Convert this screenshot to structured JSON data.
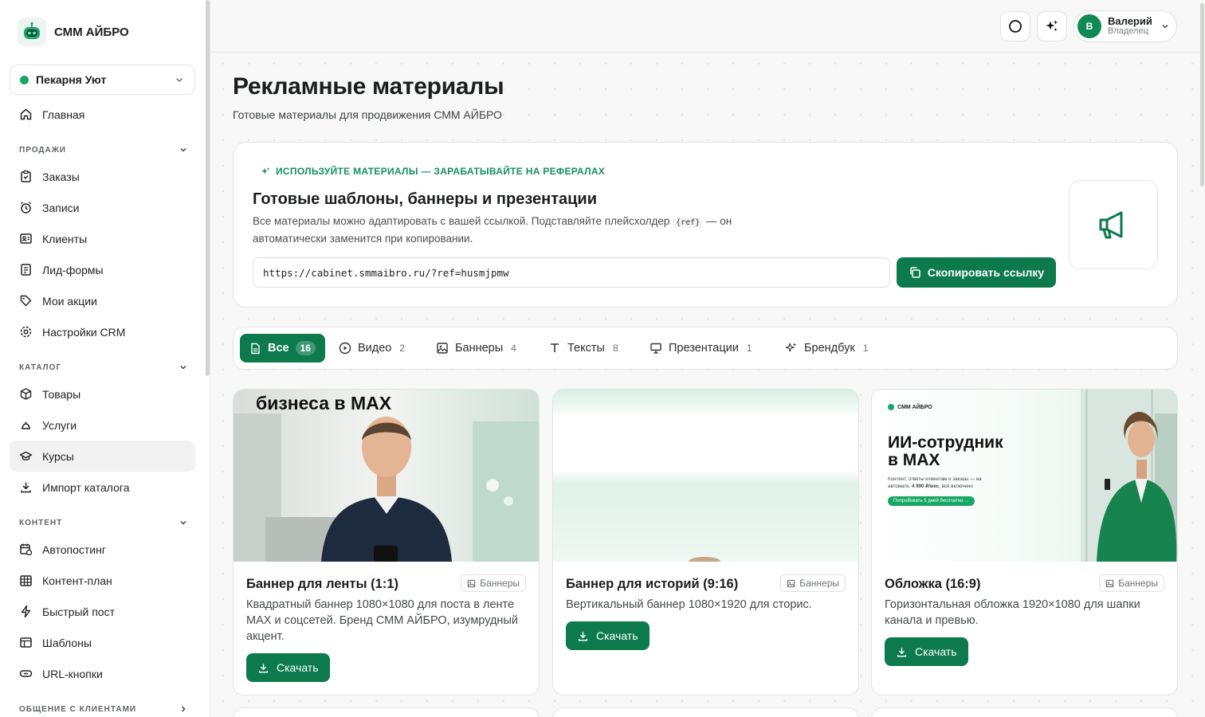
{
  "app": {
    "name": "СММ АЙБРО"
  },
  "workspace": {
    "name": "Пекарня Уют",
    "status_color": "#17a765"
  },
  "sidebar": {
    "home": "Главная",
    "sections": [
      {
        "title": "ПРОДАЖИ",
        "items": [
          "Заказы",
          "Записи",
          "Клиенты",
          "Лид-формы",
          "Мои акции",
          "Настройки CRM"
        ]
      },
      {
        "title": "КАТАЛОГ",
        "items": [
          "Товары",
          "Услуги",
          "Курсы",
          "Импорт каталога"
        ]
      },
      {
        "title": "КОНТЕНТ",
        "items": [
          "Автопостинг",
          "Контент-план",
          "Быстрый пост",
          "Шаблоны",
          "URL-кнопки"
        ]
      },
      {
        "title": "ОБЩЕНИЕ С КЛИЕНТАМИ",
        "items": []
      }
    ],
    "active_item": "Курсы"
  },
  "user": {
    "name": "Валерий",
    "role": "Владелец",
    "initial": "В"
  },
  "page": {
    "title": "Рекламные материалы",
    "subtitle": "Готовые материалы для продвижения СММ АЙБРО"
  },
  "promo": {
    "eyebrow": "ИСПОЛЬЗУЙТЕ МАТЕРИАЛЫ — ЗАРАБАТЫВАЙТЕ НА РЕФЕРАЛАХ",
    "heading": "Готовые шаблоны, баннеры и презентации",
    "text_before": "Все материалы можно адаптировать с вашей ссылкой. Подставляйте плейсхолдер",
    "placeholder": "{ref}",
    "text_after": "— он автоматически заменится при копировании.",
    "ref_link": "https://cabinet.smmaibro.ru/?ref=husmjpmw",
    "copy_label": "Скопировать ссылку"
  },
  "tabs": [
    {
      "label": "Все",
      "count": "16",
      "icon": "document-icon",
      "active": true
    },
    {
      "label": "Видео",
      "count": "2",
      "icon": "play-icon"
    },
    {
      "label": "Баннеры",
      "count": "4",
      "icon": "image-icon"
    },
    {
      "label": "Тексты",
      "count": "8",
      "icon": "text-icon"
    },
    {
      "label": "Презентации",
      "count": "1",
      "icon": "presentation-icon"
    },
    {
      "label": "Брендбук",
      "count": "1",
      "icon": "sparkles-icon"
    }
  ],
  "cards": [
    {
      "title": "Баннер для ленты (1:1)",
      "tag": "Баннеры",
      "desc": "Квадратный баннер 1080×1080 для поста в ленте MAX и соцсетей. Бренд СММ АЙБРО, изумрудный акцент.",
      "download": "Скачать",
      "image_caption": "бизнеса в MAX"
    },
    {
      "title": "Баннер для историй (9:16)",
      "tag": "Баннеры",
      "desc": "Вертикальный баннер 1080×1920 для сторис.",
      "download": "Скачать"
    },
    {
      "title": "Обложка (16:9)",
      "tag": "Баннеры",
      "desc": "Горизонтальная обложка 1920×1080 для шапки канала и превью.",
      "download": "Скачать",
      "image_brand": "СММ АЙБРО",
      "image_headline_1": "ИИ-сотрудник",
      "image_headline_2": "в MAX",
      "image_text_1": "Контент, ответы клиентам и заказы — на",
      "image_text_2": "автомате.",
      "image_price": "4 990 ₽/мес",
      "image_text_3": ", всё включено",
      "image_cta": "Попробовать 5 дней бесплатно →"
    }
  ],
  "colors": {
    "accent": "#0c7a4c",
    "accent_light": "#13915c"
  }
}
